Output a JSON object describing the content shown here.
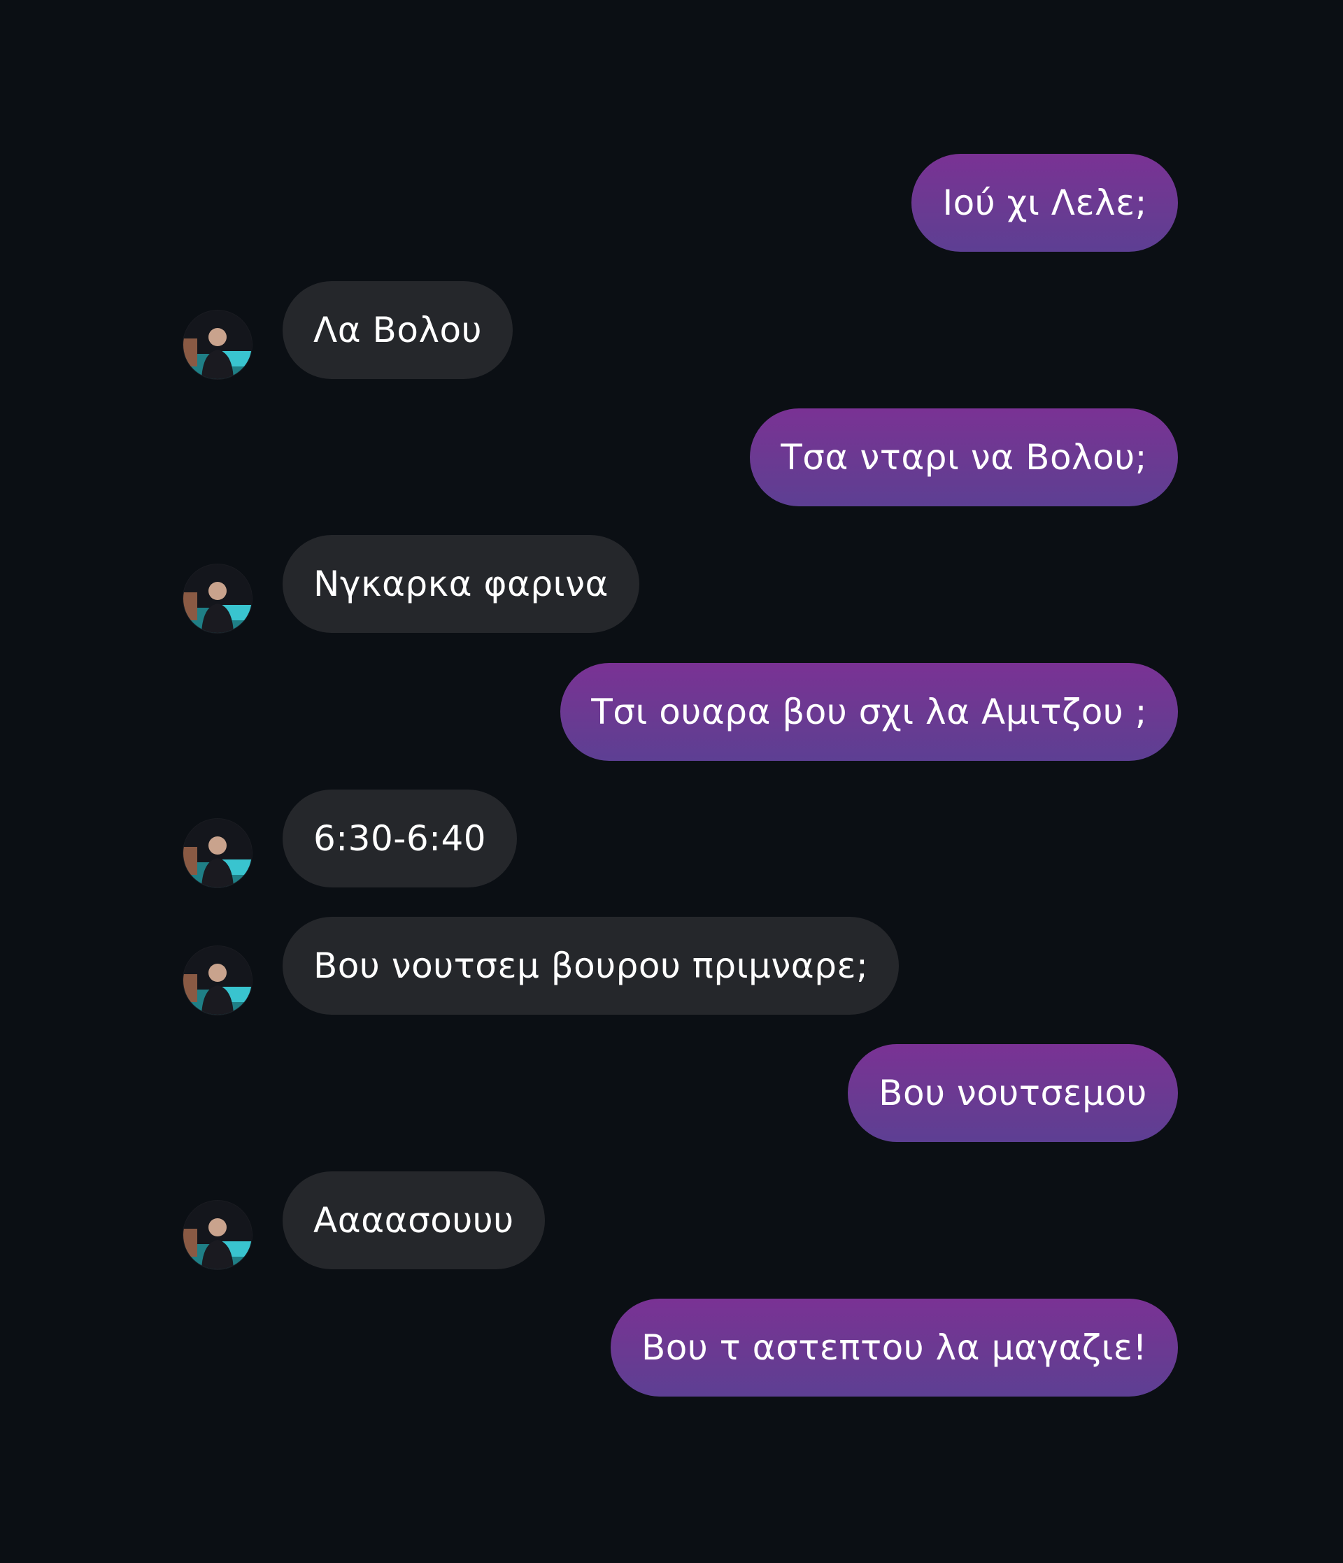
{
  "chat": {
    "messages": [
      {
        "direction": "outgoing",
        "text": "Ιού χι Λελε;"
      },
      {
        "direction": "incoming",
        "text": "Λα Βολου",
        "avatar_icon": "contact-avatar"
      },
      {
        "direction": "outgoing",
        "text": "Τσα νταρι να Βολου;"
      },
      {
        "direction": "incoming",
        "text": "Νγκαρκα φαρινα",
        "avatar_icon": "contact-avatar"
      },
      {
        "direction": "outgoing",
        "text": "Τσι ουαρα βου σχι λα Αμιτζου ;"
      },
      {
        "direction": "incoming",
        "text": "6:30-6:40",
        "avatar_icon": "contact-avatar"
      },
      {
        "direction": "incoming",
        "text": "Βου νουτσεμ βουρου πριμναρε;",
        "avatar_icon": "contact-avatar"
      },
      {
        "direction": "outgoing",
        "text": "Βου νουτσεμου"
      },
      {
        "direction": "incoming",
        "text": "Αααασουυυ",
        "avatar_icon": "contact-avatar"
      },
      {
        "direction": "outgoing",
        "text": "Βου τ αστεπτου λα μαγαζιε!"
      }
    ]
  },
  "colors": {
    "background": "#0b0f14",
    "outgoing_bubble": "#6a3a92",
    "incoming_bubble": "#25272b",
    "text": "#ffffff"
  }
}
